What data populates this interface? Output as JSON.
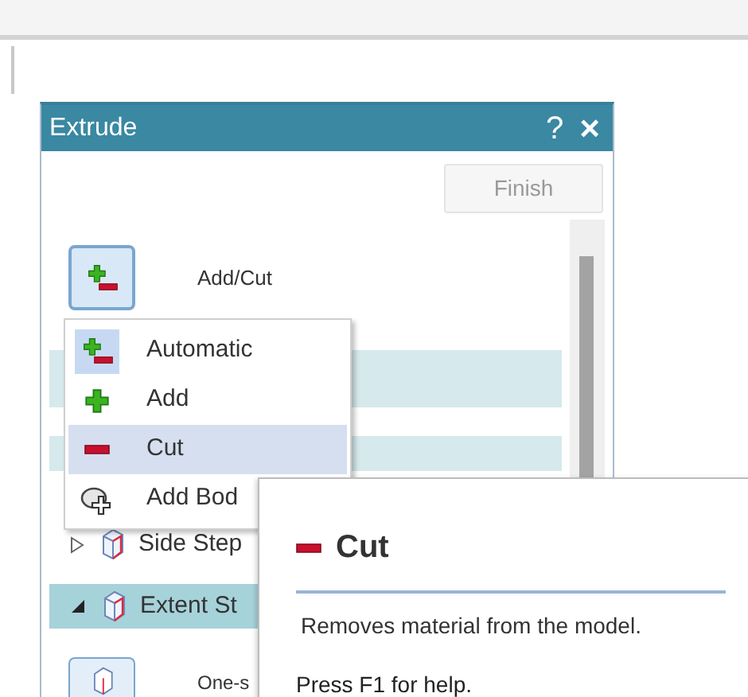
{
  "panel": {
    "title": "Extrude",
    "help": "?",
    "close": "×",
    "finish_button": {
      "label": "Finish",
      "disabled": true
    },
    "add_cut": {
      "label": "Add/Cut"
    },
    "steps": [
      {
        "label": "Side Step",
        "expanded": false,
        "selected": false
      },
      {
        "label": "Extent St",
        "expanded": true,
        "selected": true
      }
    ],
    "option_label": "One-s"
  },
  "menu": {
    "items": [
      {
        "label": "Automatic",
        "kind": "auto",
        "current": true,
        "selected": false
      },
      {
        "label": "Add",
        "kind": "add",
        "current": false,
        "selected": false
      },
      {
        "label": "Cut",
        "kind": "cut",
        "current": false,
        "selected": true
      },
      {
        "label": "Add Bod",
        "kind": "body",
        "current": false,
        "selected": false
      }
    ]
  },
  "tooltip": {
    "title": "Cut",
    "description": "Removes material from the model.",
    "hint": "Press F1 for help."
  }
}
